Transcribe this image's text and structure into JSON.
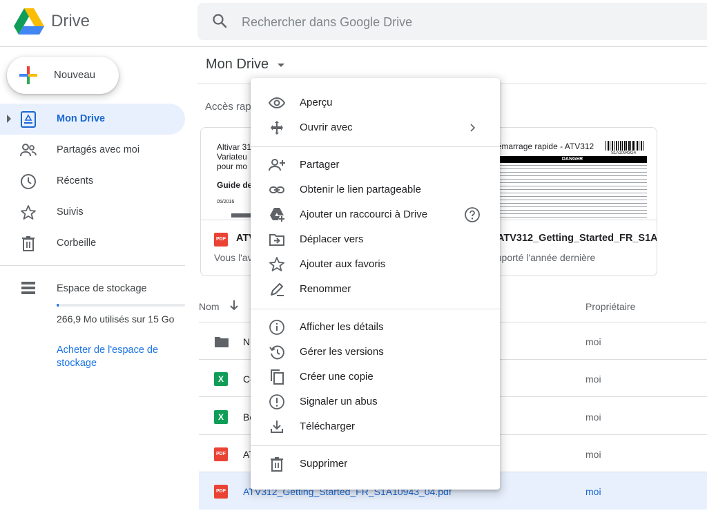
{
  "app": {
    "brand": "Drive"
  },
  "search": {
    "placeholder": "Rechercher dans Google Drive"
  },
  "sidebar": {
    "new_label": "Nouveau",
    "items": [
      {
        "label": "Mon Drive",
        "icon": "my-drive-icon",
        "active": true
      },
      {
        "label": "Partagés avec moi",
        "icon": "people-icon"
      },
      {
        "label": "Récents",
        "icon": "clock-icon"
      },
      {
        "label": "Suivis",
        "icon": "star-icon"
      },
      {
        "label": "Corbeille",
        "icon": "trash-icon"
      }
    ],
    "storage": {
      "label": "Espace de stockage",
      "used_text": "266,9 Mo utilisés sur 15 Go",
      "used_fraction": 0.017,
      "buy_link": "Acheter de l'espace de stockage"
    }
  },
  "main": {
    "title": "Mon Drive",
    "quick_access_label": "Accès rapide",
    "cards": [
      {
        "thumb_lines": [
          "Altivar 31",
          "Variateu",
          "pour mo"
        ],
        "thumb_heading": "Guide de",
        "thumb_date": "05/2016",
        "name": "ATV",
        "subtitle": "Vous l'av"
      },
      {
        "thumb_title": "Guide de démarrage rapide - ATV312",
        "thumb_code": "S1A10943G4",
        "thumb_danger": "DANGER",
        "name": "ATV312_Getting_Started_FR_S1A10…",
        "subtitle": "Importé l'année dernière"
      }
    ],
    "columns": {
      "name": "Nom",
      "owner": "Propriétaire"
    },
    "rows": [
      {
        "type": "folder",
        "name": "N",
        "owner": "moi"
      },
      {
        "type": "xls",
        "name": "Co",
        "owner": "moi"
      },
      {
        "type": "xls",
        "name": "Bo",
        "owner": "moi"
      },
      {
        "type": "pdf",
        "name": "AT",
        "owner": "moi"
      },
      {
        "type": "pdf",
        "name": "ATV312_Getting_Started_FR_S1A10943_04.pdf",
        "owner": "moi",
        "selected": true
      }
    ]
  },
  "context_menu": {
    "groups": [
      [
        {
          "label": "Aperçu",
          "icon": "eye-icon"
        },
        {
          "label": "Ouvrir avec",
          "icon": "move-arrows-icon",
          "submenu": true
        }
      ],
      [
        {
          "label": "Partager",
          "icon": "person-add-icon"
        },
        {
          "label": "Obtenir le lien partageable",
          "icon": "link-icon"
        },
        {
          "label": "Ajouter un raccourci à Drive",
          "icon": "drive-shortcut-icon",
          "help": true
        },
        {
          "label": "Déplacer vers",
          "icon": "folder-move-icon"
        },
        {
          "label": "Ajouter aux favoris",
          "icon": "star-outline-icon"
        },
        {
          "label": "Renommer",
          "icon": "pencil-icon"
        }
      ],
      [
        {
          "label": "Afficher les détails",
          "icon": "info-icon"
        },
        {
          "label": "Gérer les versions",
          "icon": "history-icon"
        },
        {
          "label": "Créer une copie",
          "icon": "copy-icon"
        },
        {
          "label": "Signaler un abus",
          "icon": "report-icon"
        },
        {
          "label": "Télécharger",
          "icon": "download-icon"
        }
      ],
      [
        {
          "label": "Supprimer",
          "icon": "trash-icon"
        }
      ]
    ]
  }
}
